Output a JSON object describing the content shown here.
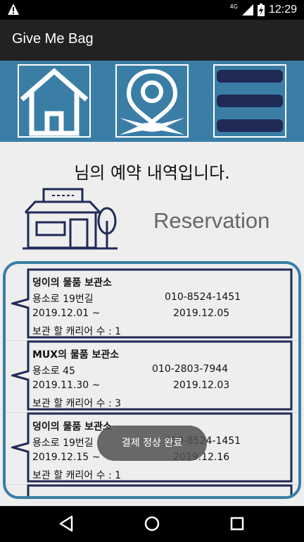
{
  "status": {
    "network": "4G",
    "time": "12:29"
  },
  "app": {
    "title": "Give Me Bag"
  },
  "toolbar": {
    "home_icon": "home-icon",
    "map_icon": "map-pin-icon",
    "menu_icon": "menu-icon"
  },
  "page": {
    "headline": "님의 예약 내역입니다.",
    "reservation_label": "Reservation"
  },
  "reservations": [
    {
      "name": "덩이의 물품 보관소",
      "address": "용소로 19번길",
      "phone": "010-8524-1451",
      "start": "2019.12.01 ~",
      "end": "2019.12.05",
      "carriers": "보관 할 캐리어 수 : 1"
    },
    {
      "name": "MUX의 물품 보관소",
      "address": "용소로 45",
      "phone": "010-2803-7944",
      "start": "2019.11.30 ~",
      "end": "2019.12.03",
      "carriers": "보관 할 캐리어 수 : 3"
    },
    {
      "name": "덩이의 물품 보관소",
      "address": "용소로 19번길",
      "phone": "010-8524-1451",
      "start": "2019.12.15 ~",
      "end": "2019.12.16",
      "carriers": "보관 할 캐리어 수 : 1"
    }
  ],
  "toast": "결제 정상 완료",
  "colors": {
    "accent": "#3a7ea6",
    "navy": "#1f2a56",
    "appbar": "#222222"
  }
}
